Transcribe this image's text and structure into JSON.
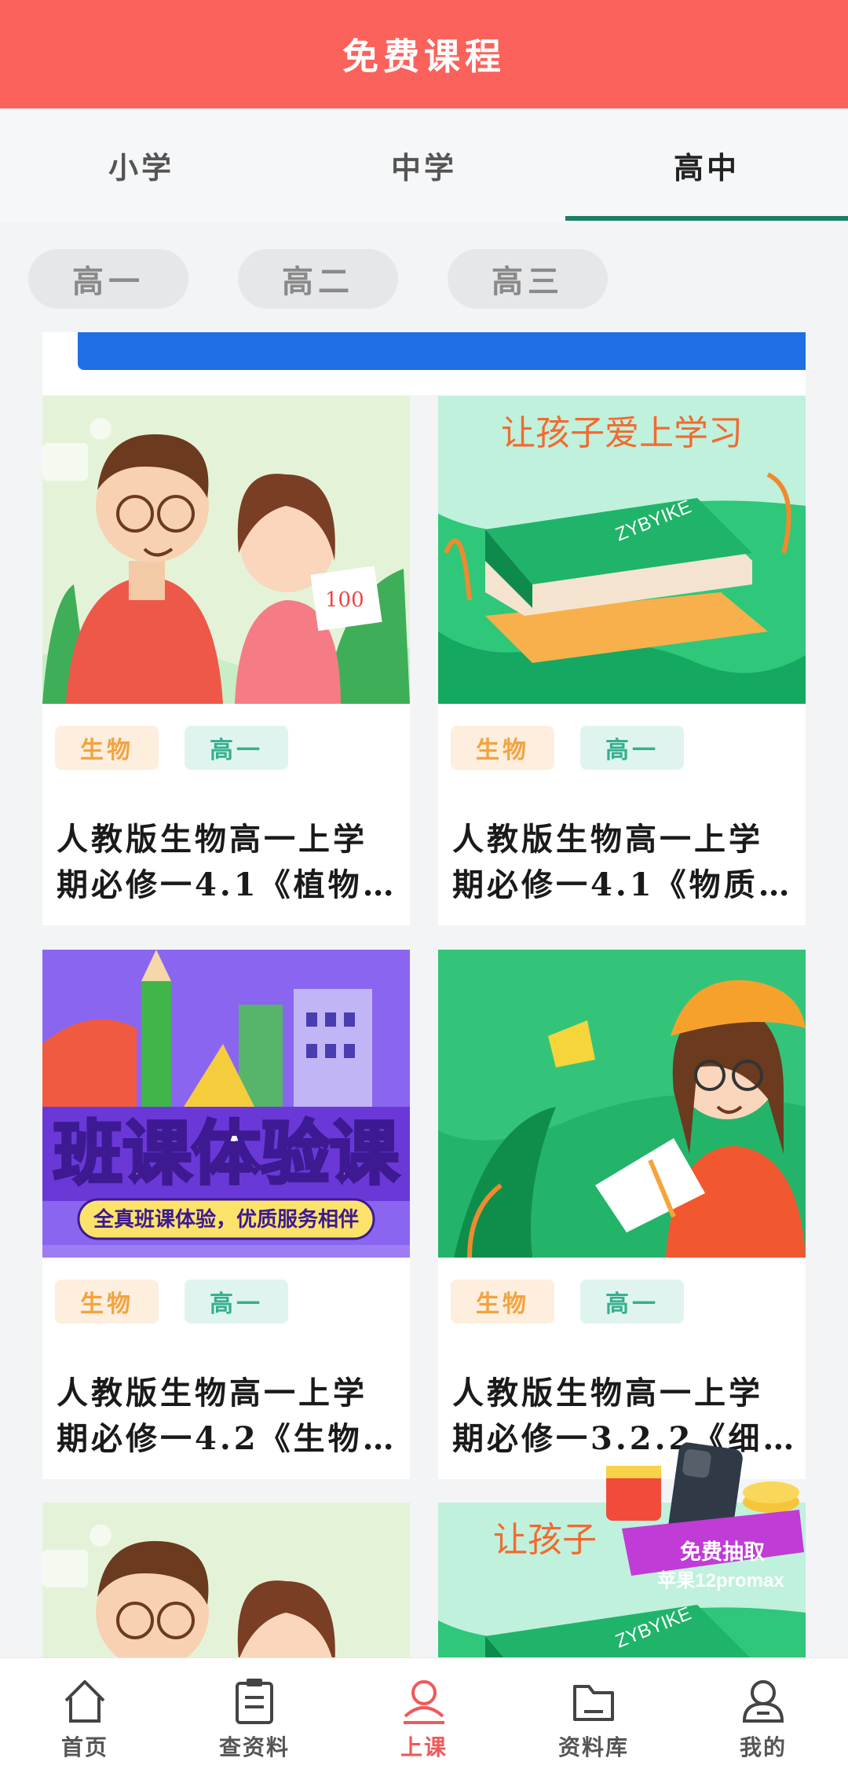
{
  "header": {
    "title": "免费课程"
  },
  "tabs": [
    {
      "label": "小学"
    },
    {
      "label": "中学"
    },
    {
      "label": "高中"
    }
  ],
  "grades": [
    {
      "label": "高一"
    },
    {
      "label": "高二"
    },
    {
      "label": "高三"
    }
  ],
  "cards": [
    {
      "subject": "生物",
      "grade": "高一",
      "title_line1": "人教版生物高一上学",
      "title_line2": "期必修一4.1《植物…"
    },
    {
      "subject": "生物",
      "grade": "高一",
      "title_line1": "人教版生物高一上学",
      "title_line2": "期必修一4.1《物质…",
      "banner_text": "让孩子爱上学习",
      "book_text": "ZYBYIKE"
    },
    {
      "subject": "生物",
      "grade": "高一",
      "title_line1": "人教版生物高一上学",
      "title_line2": "期必修一4.2《生物…",
      "banner_big": "班课体验课",
      "banner_small": "全真班课体验，优质服务相伴"
    },
    {
      "subject": "生物",
      "grade": "高一",
      "title_line1": "人教版生物高一上学",
      "title_line2": "期必修一3.2.2《细…"
    }
  ],
  "partial_cards": [
    {
      "thumb": "teacher-pair"
    },
    {
      "thumb": "book",
      "banner_text": "让孩子",
      "book_text": "ZYBYIKE"
    }
  ],
  "promo": {
    "line1": "免费抽取",
    "line2": "苹果12promax"
  },
  "bottom_nav": [
    {
      "label": "首页",
      "icon": "home-icon"
    },
    {
      "label": "查资料",
      "icon": "clipboard-icon"
    },
    {
      "label": "上课",
      "icon": "user-class-icon",
      "active": true
    },
    {
      "label": "资料库",
      "icon": "folder-icon"
    },
    {
      "label": "我的",
      "icon": "profile-icon"
    }
  ],
  "colors": {
    "header": "#fb625b",
    "tab_underline": "#1c7e69",
    "active_nav": "#f2585a",
    "banner_blue": "#1e6fe6"
  }
}
